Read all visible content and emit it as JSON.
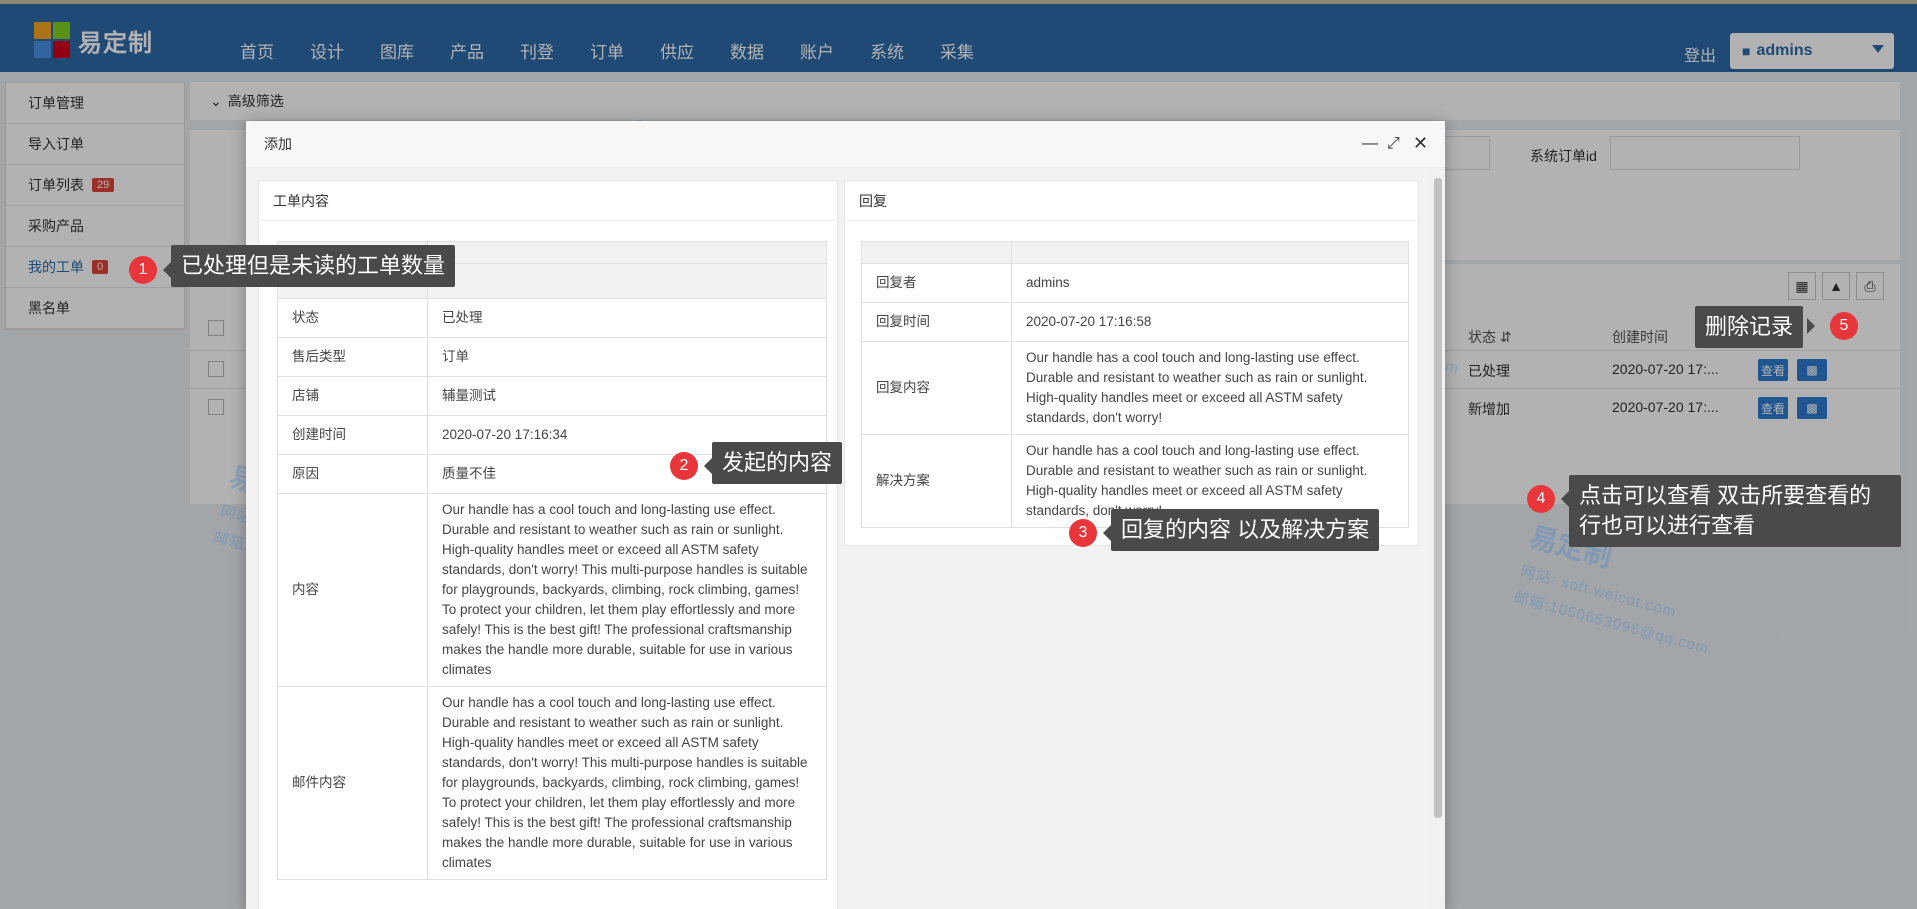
{
  "app": {
    "logo_text": "易定制",
    "nav": [
      "首页",
      "设计",
      "图库",
      "产品",
      "刊登",
      "订单",
      "供应",
      "数据",
      "账户",
      "系统",
      "采集"
    ],
    "logout": "登出",
    "user": "admins"
  },
  "sidebar": {
    "items": [
      {
        "label": "订单管理"
      },
      {
        "label": "导入订单"
      },
      {
        "label": "订单列表",
        "badge": "29"
      },
      {
        "label": "采购产品"
      },
      {
        "label": "我的工单",
        "badge": "0"
      },
      {
        "label": "黑名单"
      }
    ]
  },
  "main": {
    "filter_toggle": "高级筛选",
    "order_id_label": "系统订单id",
    "columns": {
      "status": "状态",
      "created": "创建时间"
    },
    "rows": [
      {
        "status": "已处理",
        "created": "2020-07-20 17:..."
      },
      {
        "status": "新增加",
        "created": "2020-07-20 17:..."
      }
    ],
    "view_icon": "查看",
    "delete_icon": "trash-icon"
  },
  "modal": {
    "title": "添加",
    "left_panel": {
      "title": "工单内容",
      "rows": [
        {
          "k": "状态",
          "v": "已处理"
        },
        {
          "k": "售后类型",
          "v": "订单"
        },
        {
          "k": "店铺",
          "v": "辅量测试"
        },
        {
          "k": "创建时间",
          "v": "2020-07-20 17:16:34"
        },
        {
          "k": "原因",
          "v": "质量不佳"
        },
        {
          "k": "内容",
          "v": "Our handle has a cool touch and long-lasting use effect. Durable and resistant to weather such as rain or sunlight. High-quality handles meet or exceed all ASTM safety standards, don't worry! This multi-purpose handles is suitable for playgrounds, backyards, climbing, rock climbing, games! To protect your children, let them play effortlessly and more safely! This is the best gift! The professional craftsmanship makes the handle more durable, suitable for use in various climates"
        },
        {
          "k": "邮件内容",
          "v": "Our handle has a cool touch and long-lasting use effect. Durable and resistant to weather such as rain or sunlight. High-quality handles meet or exceed all ASTM safety standards, don't worry! This multi-purpose handles is suitable for playgrounds, backyards, climbing, rock climbing, games! To protect your children, let them play effortlessly and more safely! This is the best gift! The professional craftsmanship makes the handle more durable, suitable for use in various climates"
        }
      ]
    },
    "right_panel": {
      "title": "回复",
      "rows": [
        {
          "k": "回复者",
          "v": "admins"
        },
        {
          "k": "回复时间",
          "v": "2020-07-20 17:16:58"
        },
        {
          "k": "回复内容",
          "v": "Our handle has a cool touch and long-lasting use effect. Durable and resistant to weather such as rain or sunlight. High-quality handles meet or exceed all ASTM safety standards, don't worry!"
        },
        {
          "k": "解决方案",
          "v": "Our handle has a cool touch and long-lasting use effect. Durable and resistant to weather such as rain or sunlight. High-quality handles meet or exceed all ASTM safety standards, don't worry!"
        }
      ]
    }
  },
  "annotations": [
    {
      "num": "1",
      "text": "已处理但是未读的工单数量"
    },
    {
      "num": "2",
      "text": "发起的内容"
    },
    {
      "num": "3",
      "text": "回复的内容 以及解决方案"
    },
    {
      "num": "4",
      "text": "点击可以查看 双击所要查看的行也可以进行查看"
    },
    {
      "num": "5",
      "text": "删除记录"
    }
  ],
  "watermark": {
    "brand": "易定制",
    "site": "网站: soft.weicot.com",
    "mail": "邮箱:1050653098@qq.com"
  },
  "colors": {
    "nav_bg": "#2d6aa8",
    "badge": "#e0463c",
    "callout_bg": "#4a4a4a",
    "dot": "#e8363a"
  }
}
